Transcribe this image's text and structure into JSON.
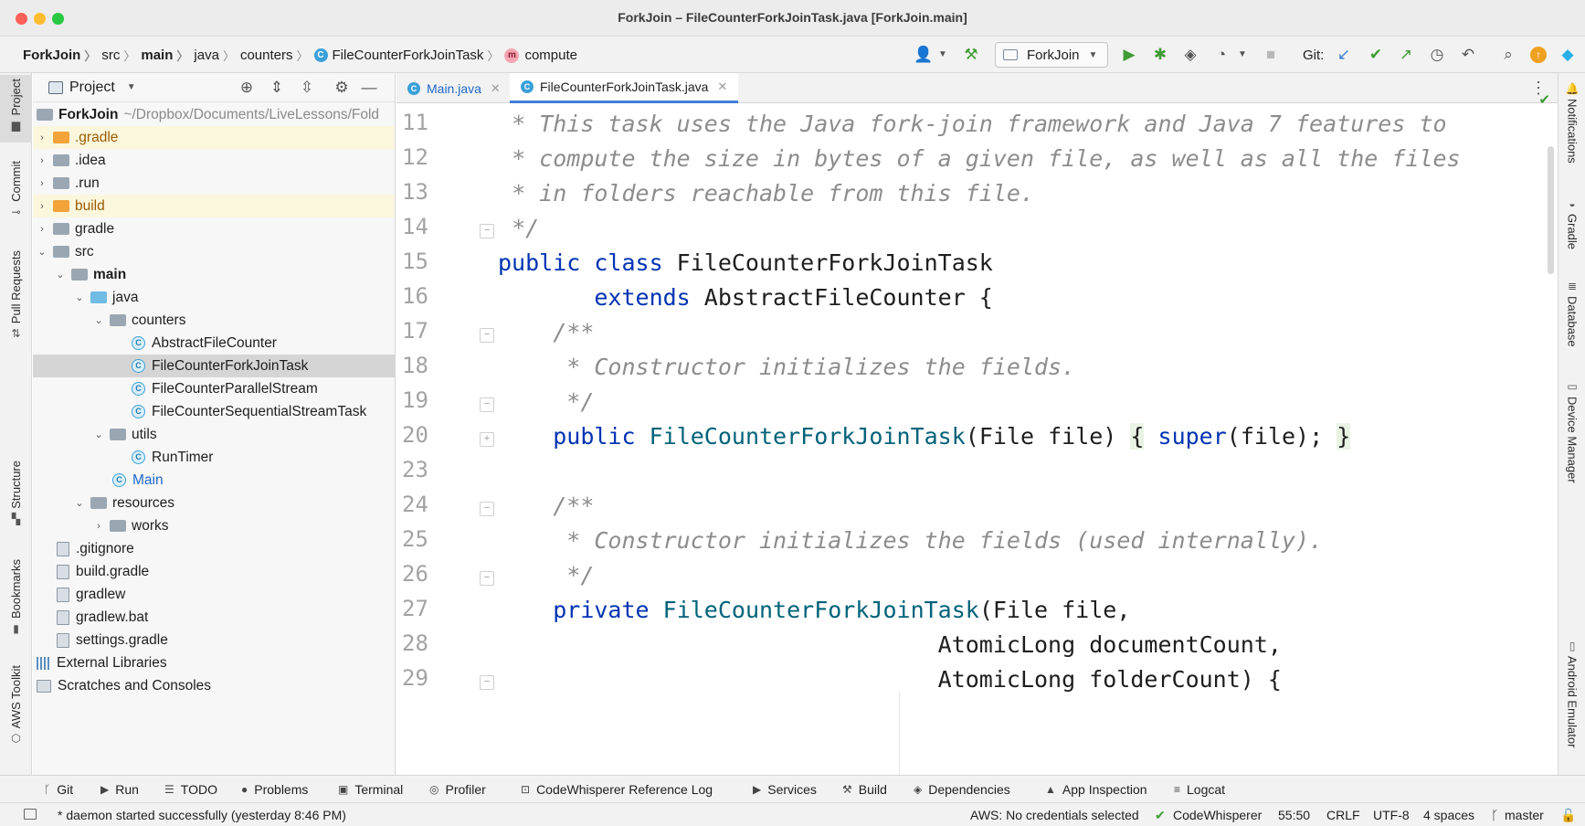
{
  "window": {
    "title": "ForkJoin – FileCounterForkJoinTask.java [ForkJoin.main]"
  },
  "breadcrumbs": {
    "items": [
      "ForkJoin",
      "src",
      "main",
      "java",
      "counters",
      "FileCounterForkJoinTask",
      "compute"
    ]
  },
  "toolbar": {
    "run_config": "ForkJoin",
    "git_label": "Git:",
    "icons": [
      "user-icon",
      "hammer-icon",
      "run-icon",
      "debug-icon",
      "coverage-icon",
      "profile-icon",
      "stop-icon",
      "git-update-icon",
      "git-commit-icon",
      "git-push-icon",
      "history-icon",
      "rollback-icon",
      "search-icon",
      "update-icon",
      "logo-icon"
    ]
  },
  "left_tools": {
    "items": [
      "Project",
      "Commit",
      "Pull Requests",
      "Structure",
      "Bookmarks",
      "AWS Toolkit"
    ]
  },
  "right_tools": {
    "items": [
      "Notifications",
      "Gradle",
      "Database",
      "Device Manager",
      "Android Emulator"
    ]
  },
  "project": {
    "title": "Project",
    "root_name": "ForkJoin",
    "root_path": "~/Dropbox/Documents/LiveLessons/Fold",
    "items": [
      {
        "label": ".gradle"
      },
      {
        "label": ".idea"
      },
      {
        "label": ".run"
      },
      {
        "label": "build"
      },
      {
        "label": "gradle"
      },
      {
        "label": "src"
      },
      {
        "label": "main"
      },
      {
        "label": "java"
      },
      {
        "label": "counters"
      },
      {
        "label": "AbstractFileCounter"
      },
      {
        "label": "FileCounterForkJoinTask"
      },
      {
        "label": "FileCounterParallelStream"
      },
      {
        "label": "FileCounterSequentialStreamTask"
      },
      {
        "label": "utils"
      },
      {
        "label": "RunTimer"
      },
      {
        "label": "Main"
      },
      {
        "label": "resources"
      },
      {
        "label": "works"
      },
      {
        "label": ".gitignore"
      },
      {
        "label": "build.gradle"
      },
      {
        "label": "gradlew"
      },
      {
        "label": "gradlew.bat"
      },
      {
        "label": "settings.gradle"
      },
      {
        "label": "External Libraries"
      },
      {
        "label": "Scratches and Consoles"
      }
    ]
  },
  "editor": {
    "tabs": [
      {
        "label": "Main.java"
      },
      {
        "label": "FileCounterForkJoinTask.java"
      }
    ],
    "line_numbers": [
      "11",
      "12",
      "13",
      "14",
      "15",
      "16",
      "17",
      "18",
      "19",
      "20",
      "23",
      "24",
      "25",
      "26",
      "27",
      "28",
      "29"
    ],
    "lines": [
      {
        "indent": " ",
        "segments": [
          {
            "t": "* This task uses the Java fork-join framework and Java 7 features to",
            "c": "cmt"
          }
        ]
      },
      {
        "indent": " ",
        "segments": [
          {
            "t": "* compute the size in bytes of a given file, as well as all the files",
            "c": "cmt"
          }
        ]
      },
      {
        "indent": " ",
        "segments": [
          {
            "t": "* in folders reachable from this file.",
            "c": "cmt"
          }
        ]
      },
      {
        "indent": " ",
        "segments": [
          {
            "t": "*/",
            "c": "cmt"
          }
        ]
      },
      {
        "indent": "",
        "segments": [
          {
            "t": "public class",
            "c": "kw"
          },
          {
            "t": " FileCounterForkJoinTask",
            "c": ""
          }
        ]
      },
      {
        "indent": "       ",
        "segments": [
          {
            "t": "extends",
            "c": "kw"
          },
          {
            "t": " AbstractFileCounter {",
            "c": ""
          }
        ]
      },
      {
        "indent": "    ",
        "segments": [
          {
            "t": "/**",
            "c": "cmt"
          }
        ]
      },
      {
        "indent": "     ",
        "segments": [
          {
            "t": "* Constructor initializes the fields.",
            "c": "cmt"
          }
        ]
      },
      {
        "indent": "     ",
        "segments": [
          {
            "t": "*/",
            "c": "cmt"
          }
        ]
      },
      {
        "indent": "    ",
        "segments": [
          {
            "t": "public",
            "c": "kw"
          },
          {
            "t": " ",
            "c": ""
          },
          {
            "t": "FileCounterForkJoinTask",
            "c": "ty"
          },
          {
            "t": "(File file) ",
            "c": ""
          },
          {
            "t": "{",
            "c": "brace-hl"
          },
          {
            "t": " ",
            "c": ""
          },
          {
            "t": "super",
            "c": "kw"
          },
          {
            "t": "(file); ",
            "c": ""
          },
          {
            "t": "}",
            "c": "brace-hl"
          }
        ]
      },
      {
        "indent": "",
        "segments": [
          {
            "t": "",
            "c": ""
          }
        ]
      },
      {
        "indent": "    ",
        "segments": [
          {
            "t": "/**",
            "c": "cmt"
          }
        ]
      },
      {
        "indent": "     ",
        "segments": [
          {
            "t": "* Constructor initializes the fields (used internally).",
            "c": "cmt"
          }
        ]
      },
      {
        "indent": "     ",
        "segments": [
          {
            "t": "*/",
            "c": "cmt"
          }
        ]
      },
      {
        "indent": "    ",
        "segments": [
          {
            "t": "private",
            "c": "kw"
          },
          {
            "t": " ",
            "c": ""
          },
          {
            "t": "FileCounterForkJoinTask",
            "c": "ty"
          },
          {
            "t": "(File file,",
            "c": ""
          }
        ]
      },
      {
        "indent": "                                ",
        "segments": [
          {
            "t": "AtomicLong documentCount,",
            "c": ""
          }
        ]
      },
      {
        "indent": "                                ",
        "segments": [
          {
            "t": "AtomicLong folderCount) {",
            "c": ""
          }
        ]
      }
    ]
  },
  "bottom_tools": {
    "items": [
      "Git",
      "Run",
      "TODO",
      "Problems",
      "Terminal",
      "Profiler",
      "CodeWhisperer Reference Log",
      "Services",
      "Build",
      "Dependencies",
      "App Inspection",
      "Logcat"
    ]
  },
  "status": {
    "message": "* daemon started successfully (yesterday 8:46 PM)",
    "aws": "AWS: No credentials selected",
    "codewhisperer": "CodeWhisperer",
    "position": "55:50",
    "line_sep": "CRLF",
    "encoding": "UTF-8",
    "indent": "4 spaces",
    "branch": "master"
  },
  "colors": {
    "keyword": "#0033b3",
    "type": "#00627a",
    "comment": "#8c8c8c",
    "accent": "#3f7fd6"
  }
}
